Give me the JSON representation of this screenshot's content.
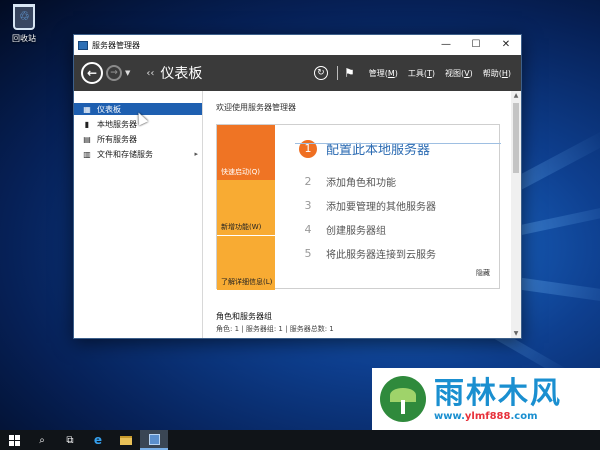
{
  "desktop": {
    "recycle_bin_label": "回收站"
  },
  "window": {
    "title": "服务器管理器",
    "controls": {
      "minimize": "—",
      "maximize": "☐",
      "close": "✕"
    }
  },
  "toolbar": {
    "breadcrumb_arrow": "‹‹",
    "breadcrumb": "仪表板",
    "menus": [
      {
        "text": "管理",
        "key": "M"
      },
      {
        "text": "工具",
        "key": "T"
      },
      {
        "text": "视图",
        "key": "V"
      },
      {
        "text": "帮助",
        "key": "H"
      }
    ]
  },
  "sidebar": {
    "items": [
      {
        "label": "仪表板",
        "icon": "dashboard-icon",
        "glyph": "▦"
      },
      {
        "label": "本地服务器",
        "icon": "server-icon",
        "glyph": "▮"
      },
      {
        "label": "所有服务器",
        "icon": "servers-icon",
        "glyph": "▤"
      },
      {
        "label": "文件和存储服务",
        "icon": "storage-icon",
        "glyph": "▥",
        "chevron": "▸"
      }
    ]
  },
  "main": {
    "welcome": "欢迎使用服务器管理器",
    "blocks": [
      "快速启动(Q)",
      "新增功能(W)",
      "了解详细信息(L)"
    ],
    "primary_task": {
      "num": "1",
      "label": "配置此本地服务器"
    },
    "tasks": [
      {
        "num": "2",
        "label": "添加角色和功能"
      },
      {
        "num": "3",
        "label": "添加要管理的其他服务器"
      },
      {
        "num": "4",
        "label": "创建服务器组"
      },
      {
        "num": "5",
        "label": "将此服务器连接到云服务"
      }
    ],
    "hide": "隐藏",
    "roles_title": "角色和服务器组",
    "roles_subtitle": "角色: 1 | 服务器组: 1 | 服务器总数: 1"
  },
  "watermark": {
    "brand": "雨林木风",
    "url_prefix": "www.",
    "url_mid": "ylmf888",
    "url_suffix": ".com"
  },
  "colors": {
    "toolbar": "#3a3a3a",
    "active_nav": "#1e5fb0",
    "quick_start": "#ef7424",
    "tiles": "#f8ab33",
    "link": "#2a6ab2"
  }
}
